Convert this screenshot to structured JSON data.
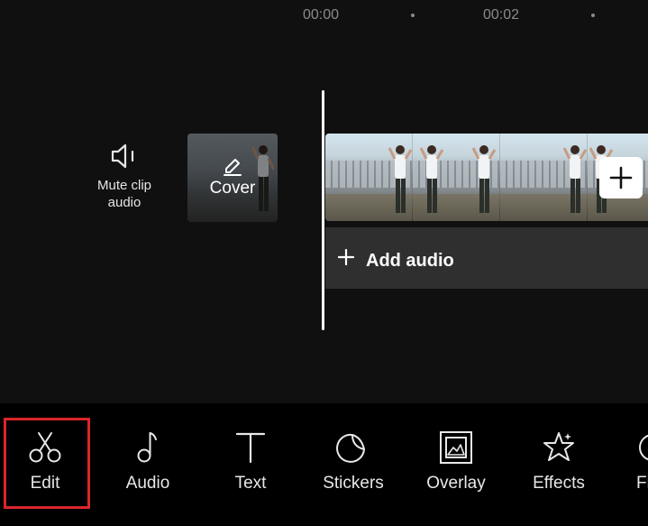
{
  "timeline": {
    "ticks": [
      "00:00",
      "00:02"
    ]
  },
  "mute": {
    "label_line1": "Mute clip",
    "label_line2": "audio"
  },
  "cover": {
    "label": "Cover"
  },
  "audio_track": {
    "label": "Add audio"
  },
  "toolbar": {
    "items": [
      {
        "label": "Edit",
        "icon": "scissors-icon",
        "selected": true
      },
      {
        "label": "Audio",
        "icon": "music-note-icon"
      },
      {
        "label": "Text",
        "icon": "text-icon"
      },
      {
        "label": "Stickers",
        "icon": "sticker-icon"
      },
      {
        "label": "Overlay",
        "icon": "overlay-icon"
      },
      {
        "label": "Effects",
        "icon": "effects-star-icon"
      },
      {
        "label": "Fi",
        "icon": "filter-icon"
      }
    ]
  },
  "colors": {
    "background": "#101010",
    "toolbar_bg": "#000000",
    "audio_bar_bg": "#2f2f2f",
    "selection": "#d9262b"
  }
}
